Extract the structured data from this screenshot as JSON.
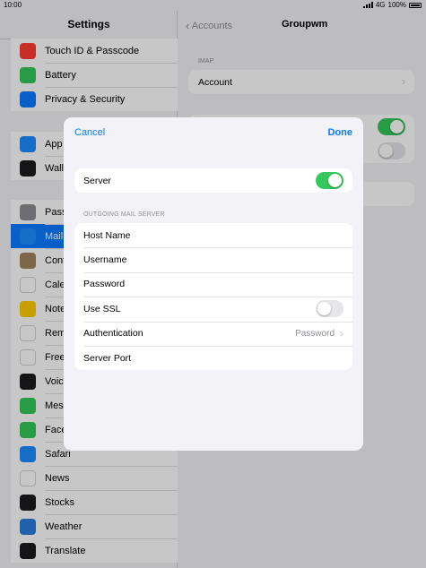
{
  "status": {
    "time": "10:00",
    "network": "4G",
    "battery": "100%"
  },
  "sidebar": {
    "title": "Settings",
    "group1": [
      {
        "label": "Touch ID & Passcode",
        "icon": "fingerprint-icon",
        "color": "#ff3b30"
      },
      {
        "label": "Battery",
        "icon": "battery-icon",
        "color": "#34c759"
      },
      {
        "label": "Privacy & Security",
        "icon": "hand-icon",
        "color": "#0a7aff"
      }
    ],
    "group2": [
      {
        "label": "App",
        "icon": "appstore-icon",
        "color": "#1c8cff"
      },
      {
        "label": "Walle",
        "icon": "wallet-icon",
        "color": "#1c1c1e"
      }
    ],
    "group3": [
      {
        "label": "Pass",
        "icon": "key-icon",
        "color": "#8e8e93"
      },
      {
        "label": "Mail",
        "icon": "mail-icon",
        "color": "#1c8cff",
        "selected": true
      },
      {
        "label": "Cont",
        "icon": "contacts-icon",
        "color": "#a2845e"
      },
      {
        "label": "Cale",
        "icon": "calendar-icon",
        "color": "#ffffff"
      },
      {
        "label": "Note",
        "icon": "notes-icon",
        "color": "#ffcc00"
      },
      {
        "label": "Rem",
        "icon": "reminders-icon",
        "color": "#ffffff"
      },
      {
        "label": "Free",
        "icon": "freeform-icon",
        "color": "#ffffff"
      },
      {
        "label": "Voic",
        "icon": "voicememos-icon",
        "color": "#1c1c1e"
      },
      {
        "label": "Mess",
        "icon": "messages-icon",
        "color": "#34c759"
      },
      {
        "label": "Face",
        "icon": "facetime-icon",
        "color": "#34c759"
      },
      {
        "label": "Safari",
        "icon": "safari-icon",
        "color": "#1c8cff"
      },
      {
        "label": "News",
        "icon": "news-icon",
        "color": "#ffffff"
      },
      {
        "label": "Stocks",
        "icon": "stocks-icon",
        "color": "#1c1c1e"
      },
      {
        "label": "Weather",
        "icon": "weather-icon",
        "color": "#2a7bde"
      },
      {
        "label": "Translate",
        "icon": "translate-icon",
        "color": "#1c1c1e"
      }
    ]
  },
  "detail": {
    "back_label": "Accounts",
    "title": "Groupwm",
    "section_header": "IMAP",
    "account_label": "Account"
  },
  "modal": {
    "cancel_label": "Cancel",
    "done_label": "Done",
    "server_label": "Server",
    "server_on": true,
    "section_header": "OUTGOING MAIL SERVER",
    "host_label": "Host Name",
    "username_label": "Username",
    "password_label": "Password",
    "ssl_label": "Use SSL",
    "ssl_on": false,
    "auth_label": "Authentication",
    "auth_value": "Password",
    "port_label": "Server Port"
  }
}
